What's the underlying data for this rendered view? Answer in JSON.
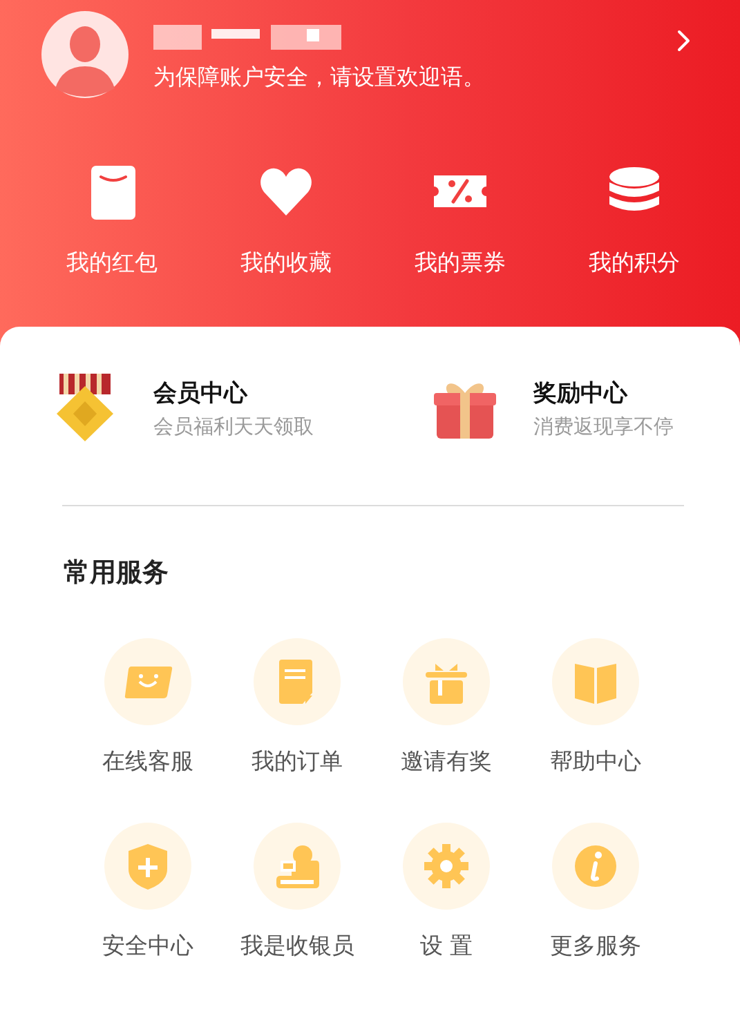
{
  "profile": {
    "greeting": "为保障账户安全，请设置欢迎语。"
  },
  "quick_links": [
    {
      "kind": "envelope",
      "label": "我的红包"
    },
    {
      "kind": "heart",
      "label": "我的收藏"
    },
    {
      "kind": "ticket",
      "label": "我的票券"
    },
    {
      "kind": "coins",
      "label": "我的积分"
    }
  ],
  "promos": [
    {
      "kind": "medal",
      "title": "会员中心",
      "subtitle": "会员福利天天领取"
    },
    {
      "kind": "gift",
      "title": "奖励中心",
      "subtitle": "消费返现享不停"
    }
  ],
  "services": {
    "title": "常用服务",
    "items": [
      {
        "kind": "smile",
        "label": "在线客服"
      },
      {
        "kind": "document",
        "label": "我的订单"
      },
      {
        "kind": "giftbox",
        "label": "邀请有奖"
      },
      {
        "kind": "book",
        "label": "帮助中心"
      },
      {
        "kind": "shield",
        "label": "安全中心"
      },
      {
        "kind": "cashier",
        "label": "我是收银员"
      },
      {
        "kind": "gear",
        "label": "设 置"
      },
      {
        "kind": "info",
        "label": "更多服务"
      }
    ]
  }
}
